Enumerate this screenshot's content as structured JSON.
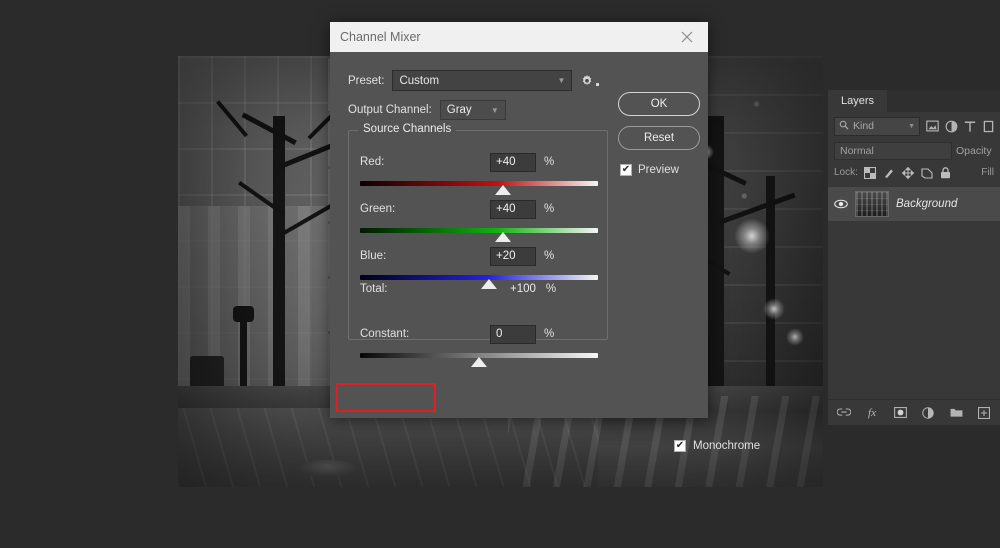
{
  "photo": {
    "alt_description": "Black and white night city street with bare trees, storefront windows and string lights"
  },
  "dialog": {
    "title": "Channel Mixer",
    "close_icon": "close-icon",
    "preset": {
      "label": "Preset:",
      "value": "Custom",
      "caret_icon": "chevron-down-icon"
    },
    "gear_icon": "gear-icon",
    "output_channel": {
      "label": "Output Channel:",
      "value": "Gray",
      "caret_icon": "chevron-down-icon"
    },
    "buttons": {
      "ok": "OK",
      "reset": "Reset"
    },
    "preview": {
      "label": "Preview",
      "checked": true,
      "check_glyph": "✔"
    },
    "source_channels": {
      "legend": "Source Channels",
      "channels": [
        {
          "name": "Red:",
          "value": "+40",
          "unit": "%",
          "thumb_pct": 60,
          "track": "red"
        },
        {
          "name": "Green:",
          "value": "+40",
          "unit": "%",
          "thumb_pct": 60,
          "track": "green"
        },
        {
          "name": "Blue:",
          "value": "+20",
          "unit": "%",
          "thumb_pct": 54,
          "track": "blue"
        }
      ],
      "total": {
        "label": "Total:",
        "value": "+100",
        "unit": "%"
      }
    },
    "constant": {
      "label": "Constant:",
      "value": "0",
      "unit": "%",
      "thumb_pct": 50,
      "track": "gray"
    },
    "monochrome": {
      "label": "Monochrome",
      "checked": true,
      "check_glyph": "✔",
      "highlight_color": "#e02020"
    }
  },
  "layers_panel": {
    "tab": "Layers",
    "filter": {
      "kind_label": "Kind",
      "search_icon": "search-icon",
      "caret_icon": "chevron-down-icon",
      "icons": [
        "image-filter-icon",
        "adjustment-filter-icon",
        "type-filter-icon",
        "shape-filter-icon"
      ]
    },
    "blend_mode": "Normal",
    "opacity_label": "Opacity",
    "lock": {
      "label": "Lock:",
      "icons": [
        "lock-transparency-icon",
        "lock-image-icon",
        "lock-position-icon",
        "lock-artboard-icon",
        "lock-all-icon"
      ],
      "fill_label": "Fill"
    },
    "layers": [
      {
        "name": "Background",
        "visible": true,
        "eye_icon": "eye-icon",
        "thumbnail": "layer-thumbnail"
      }
    ],
    "bottom_icons": [
      "link-layers-icon",
      "layer-style-fx-icon",
      "layer-mask-icon",
      "adjustment-layer-icon",
      "new-group-icon",
      "new-layer-icon"
    ]
  }
}
